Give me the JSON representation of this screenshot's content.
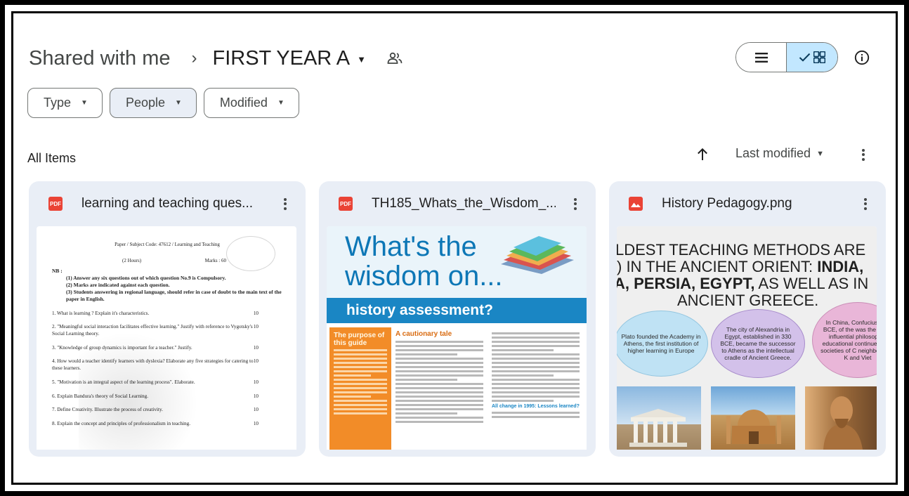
{
  "breadcrumb": {
    "root": "Shared with me",
    "separator": "›",
    "current": "FIRST YEAR A",
    "caret": "▼"
  },
  "view_toggle": {
    "list_icon": "list-icon",
    "grid_icon": "grid-icon",
    "selected": "grid"
  },
  "filters": [
    {
      "label": "Type"
    },
    {
      "label": "People"
    },
    {
      "label": "Modified"
    }
  ],
  "section": {
    "title": "All Items",
    "sort_label": "Last modified",
    "sort_direction": "ascending"
  },
  "colors": {
    "selected_toggle": "#c2e7ff",
    "card_background": "#e9eef6",
    "pdf_red": "#ea4335"
  },
  "files": [
    {
      "name": "learning and teaching ques...",
      "type_badge": "PDF",
      "preview": {
        "paper_code": "Paper / Subject Code: 47612 / Learning and Teaching",
        "hours": "(2 Hours)",
        "marks": "Marks : 60",
        "nb_label": "NB :",
        "instructions": [
          "(1)  Answer any six questions out of which question No.9 is Compulsory.",
          "(2)  Marks are indicated against each question.",
          "(3)  Students answering in regional language, should refer in case of doubt to the main text of the paper in English."
        ],
        "questions": [
          {
            "text": "1.  What is learning ? Explain it's characteristics.",
            "marks": "10"
          },
          {
            "text": "2.  \"Meaningful social interaction facilitates effective learning.\" Justify with reference to Vygotsky's Social Learning theory.",
            "marks": "10"
          },
          {
            "text": "3.  \"Knowledge of group dynamics is important for a teacher.\" Justify.",
            "marks": "10"
          },
          {
            "text": "4.  How would a teacher identify learners with dyslexia? Elaborate any five strategies for catering to these learners.",
            "marks": "10"
          },
          {
            "text": "5.  \"Motivation is an integral aspect of the learning process\". Elaborate.",
            "marks": "10"
          },
          {
            "text": "6.  Explain Bandura's theory of Social Learning.",
            "marks": "10"
          },
          {
            "text": "7.  Define Creativity. Illustrate the process of creativity.",
            "marks": "10"
          },
          {
            "text": "8.  Explain the concept and principles of professionalism in teaching.",
            "marks": "10"
          }
        ]
      }
    },
    {
      "name": "TH185_Whats_the_Wisdom_...",
      "type_badge": "PDF",
      "preview": {
        "title_line1": "What's the",
        "title_line2": "wisdom on...",
        "band": "history assessment?",
        "sidebar_heading": "The purpose of this guide",
        "column_heading": "A cautionary tale",
        "lower_heading": "All change in 1995: Lessons learned?"
      }
    },
    {
      "name": "History Pedagogy.png",
      "type_badge": "",
      "preview": {
        "line1": "LDEST TEACHING METHODS ARE",
        "line2_normal": ") IN THE ANCIENT ORIENT: ",
        "line2_bold": "INDIA,",
        "line3_bold": "A, PERSIA, EGYPT,",
        "line3_normal": " AS WELL AS IN",
        "line4": "ANCIENT GREECE.",
        "oval1": "Plato founded the Academy in Athens, the first institution of higher learning in Europe",
        "oval2": "The city of Alexandria in Egypt, established in 330 BCE, became the successor to Athens as the intellectual cradle of Ancient Greece.",
        "oval3": "In China, Confucius 479 BCE, of the was the count influential philosopher educational continues to in societies of C neighbors like K and Viet"
      }
    }
  ]
}
